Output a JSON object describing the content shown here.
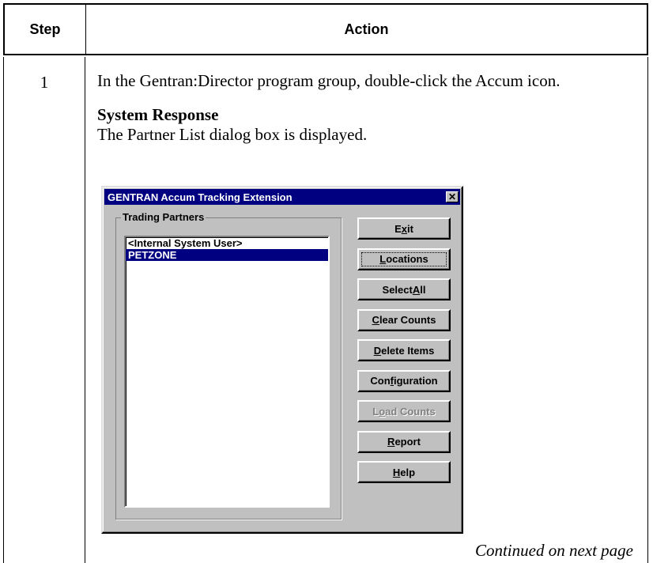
{
  "table": {
    "header_step": "Step",
    "header_action": "Action",
    "step_number": "1",
    "instruction": "In the Gentran:Director program group, double-click the Accum icon.",
    "system_response_heading": "System Response",
    "system_response_text": "The Partner List dialog box is displayed.",
    "continued": "Continued on next page"
  },
  "dialog": {
    "title": "GENTRAN Accum Tracking Extension",
    "group_label": "Trading Partners",
    "partners": [
      {
        "label": "<Internal System User>",
        "selected": false
      },
      {
        "label": "PETZONE",
        "selected": true
      }
    ],
    "buttons": [
      {
        "pre": "E",
        "u": "x",
        "post": "it",
        "enabled": true
      },
      {
        "pre": "",
        "u": "L",
        "post": "ocations",
        "enabled": true
      },
      {
        "pre": "Select ",
        "u": "A",
        "post": "ll",
        "enabled": true
      },
      {
        "pre": "",
        "u": "C",
        "post": "lear Counts",
        "enabled": true
      },
      {
        "pre": "",
        "u": "D",
        "post": "elete Items",
        "enabled": true
      },
      {
        "pre": "Con",
        "u": "f",
        "post": "iguration",
        "enabled": true
      },
      {
        "pre": "L",
        "u": "o",
        "post": "ad Counts",
        "enabled": false
      },
      {
        "pre": "",
        "u": "R",
        "post": "eport",
        "enabled": true
      },
      {
        "pre": "",
        "u": "H",
        "post": "elp",
        "enabled": true
      }
    ]
  },
  "colors": {
    "titlebar": "#000080",
    "dialog_face": "#c0c0c0",
    "selection": "#000080"
  }
}
